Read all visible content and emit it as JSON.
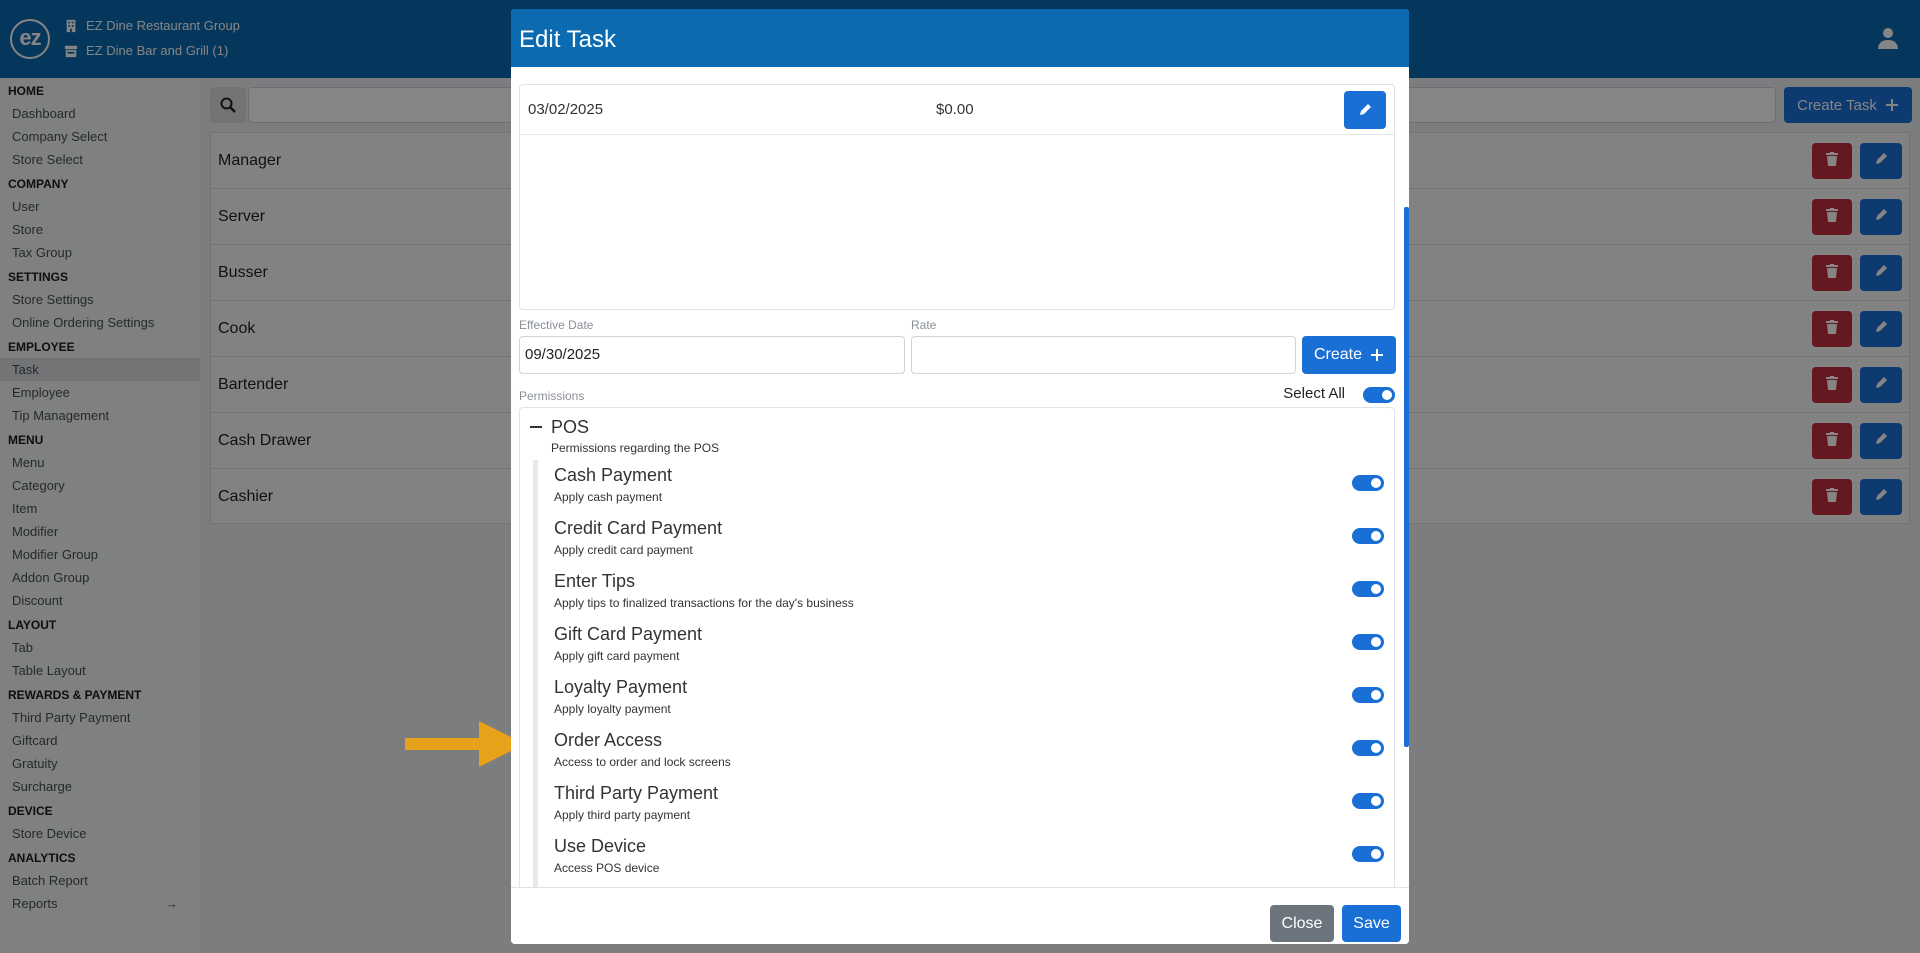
{
  "header": {
    "logo_text": "ez",
    "company": "EZ Dine Restaurant Group",
    "store": "EZ Dine Bar and Grill (1)"
  },
  "sidebar": {
    "sections": [
      {
        "title": "HOME",
        "items": [
          "Dashboard",
          "Company Select",
          "Store Select"
        ]
      },
      {
        "title": "COMPANY",
        "items": [
          "User",
          "Store",
          "Tax Group"
        ]
      },
      {
        "title": "SETTINGS",
        "items": [
          "Store Settings",
          "Online Ordering Settings"
        ]
      },
      {
        "title": "EMPLOYEE",
        "items": [
          "Task",
          "Employee",
          "Tip Management"
        ]
      },
      {
        "title": "MENU",
        "items": [
          "Menu",
          "Category",
          "Item",
          "Modifier",
          "Modifier Group",
          "Addon Group",
          "Discount"
        ]
      },
      {
        "title": "LAYOUT",
        "items": [
          "Tab",
          "Table Layout"
        ]
      },
      {
        "title": "REWARDS & PAYMENT",
        "items": [
          "Third Party Payment",
          "Giftcard",
          "Gratuity",
          "Surcharge"
        ]
      },
      {
        "title": "DEVICE",
        "items": [
          "Store Device"
        ]
      },
      {
        "title": "ANALYTICS",
        "items": [
          "Batch Report",
          "Reports"
        ]
      }
    ],
    "active_item": "Task"
  },
  "main": {
    "create_task_label": "Create Task",
    "tasks": [
      "Manager",
      "Server",
      "Busser",
      "Cook",
      "Bartender",
      "Cash Drawer",
      "Cashier"
    ]
  },
  "modal": {
    "title": "Edit Task",
    "rate_row": {
      "date": "03/02/2025",
      "amount": "$0.00"
    },
    "effective_date_label": "Effective Date",
    "effective_date_value": "09/30/2025",
    "rate_label": "Rate",
    "rate_value": "",
    "create_label": "Create",
    "permissions_label": "Permissions",
    "select_all_label": "Select All",
    "select_all_on": true,
    "group": {
      "title": "POS",
      "description": "Permissions regarding the POS",
      "permissions": [
        {
          "name": "Cash Payment",
          "description": "Apply cash payment",
          "enabled": true
        },
        {
          "name": "Credit Card Payment",
          "description": "Apply credit card payment",
          "enabled": true
        },
        {
          "name": "Enter Tips",
          "description": "Apply tips to finalized transactions for the day's business",
          "enabled": true
        },
        {
          "name": "Gift Card Payment",
          "description": "Apply gift card payment",
          "enabled": true
        },
        {
          "name": "Loyalty Payment",
          "description": "Apply loyalty payment",
          "enabled": true
        },
        {
          "name": "Order Access",
          "description": "Access to order and lock screens",
          "enabled": true
        },
        {
          "name": "Third Party Payment",
          "description": "Apply third party payment",
          "enabled": true
        },
        {
          "name": "Use Device",
          "description": "Access POS device",
          "enabled": true
        }
      ]
    },
    "close_label": "Close",
    "save_label": "Save"
  },
  "colors": {
    "brand_header": "#0b6ab0",
    "primary": "#1a6fd6",
    "danger": "#c12f3d",
    "secondary": "#6c757d",
    "callout_arrow": "#e7a21b"
  }
}
